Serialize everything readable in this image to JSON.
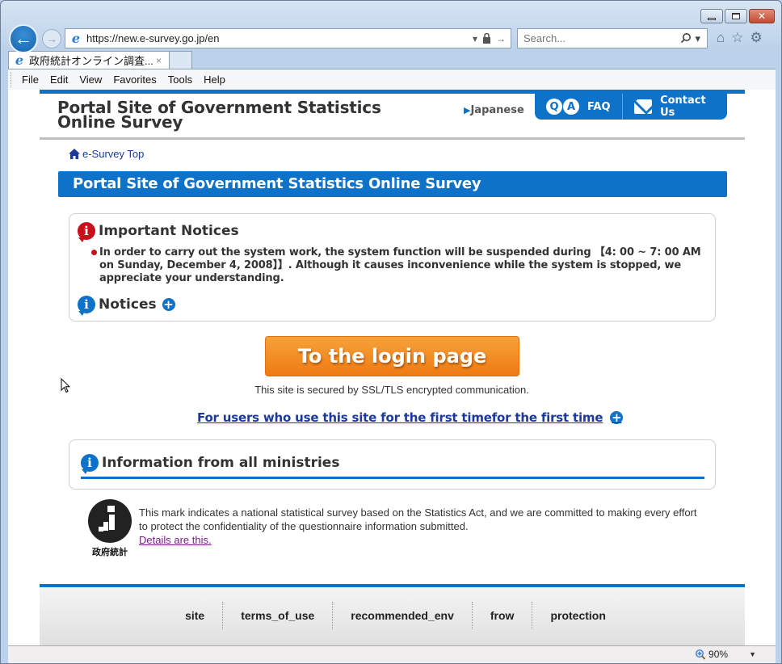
{
  "browser": {
    "address_url": "https://new.e-survey.go.jp/en",
    "search_placeholder": "Search...",
    "tab_title": "政府統計オンライン調査...",
    "tab_close": "×",
    "menu": [
      "File",
      "Edit",
      "View",
      "Favorites",
      "Tools",
      "Help"
    ],
    "zoom_level": "90%",
    "icons": {
      "back": "←",
      "forward": "→",
      "dropdown": "▾",
      "lock": "🔒",
      "go": "→",
      "search": "⚲",
      "home": "⌂",
      "favorites": "☆",
      "settings": "⚙",
      "close": "✕"
    }
  },
  "site": {
    "header_title": "Portal Site of Government Statistics Online Survey",
    "language_link": "Japanese",
    "faq_label": "FAQ",
    "contact_label": "Contact Us",
    "qa_glyphs": [
      "Q",
      "A"
    ],
    "breadcrumb": "e-Survey Top",
    "page_banner": "Portal Site of Government Statistics Online Survey",
    "important_notices": {
      "heading": "Important Notices",
      "items": [
        "In order to carry out the system work, the system function will be suspended during 【4: 00 ~ 7: 00 AM on Sunday, December 4, 2008】】. Although it causes inconvenience while the system is stopped, we appreciate your understanding."
      ]
    },
    "notices_heading": "Notices",
    "login_button": "To the login page",
    "ssl_note": "This site is secured by SSL/TLS encrypted communication.",
    "first_time_link": "For users who use this site for the first timefor the first time",
    "info_heading": "Information from all ministries",
    "mark_label": "政府統計",
    "mark_text": "This mark indicates a national statistical survey based on the Statistics Act, and we are committed to making every effort to protect the confidentiality of the questionnaire information submitted.",
    "details_link": "Details are this.",
    "footer_links": [
      "site",
      "terms_of_use",
      "recommended_env",
      "frow",
      "protection"
    ]
  },
  "colors": {
    "brand_blue": "#0f72c9",
    "login_orange": "#f08518",
    "important_red": "#c8101c",
    "link_blue": "#1a3a9e",
    "visited_purple": "#7b1e8b"
  }
}
